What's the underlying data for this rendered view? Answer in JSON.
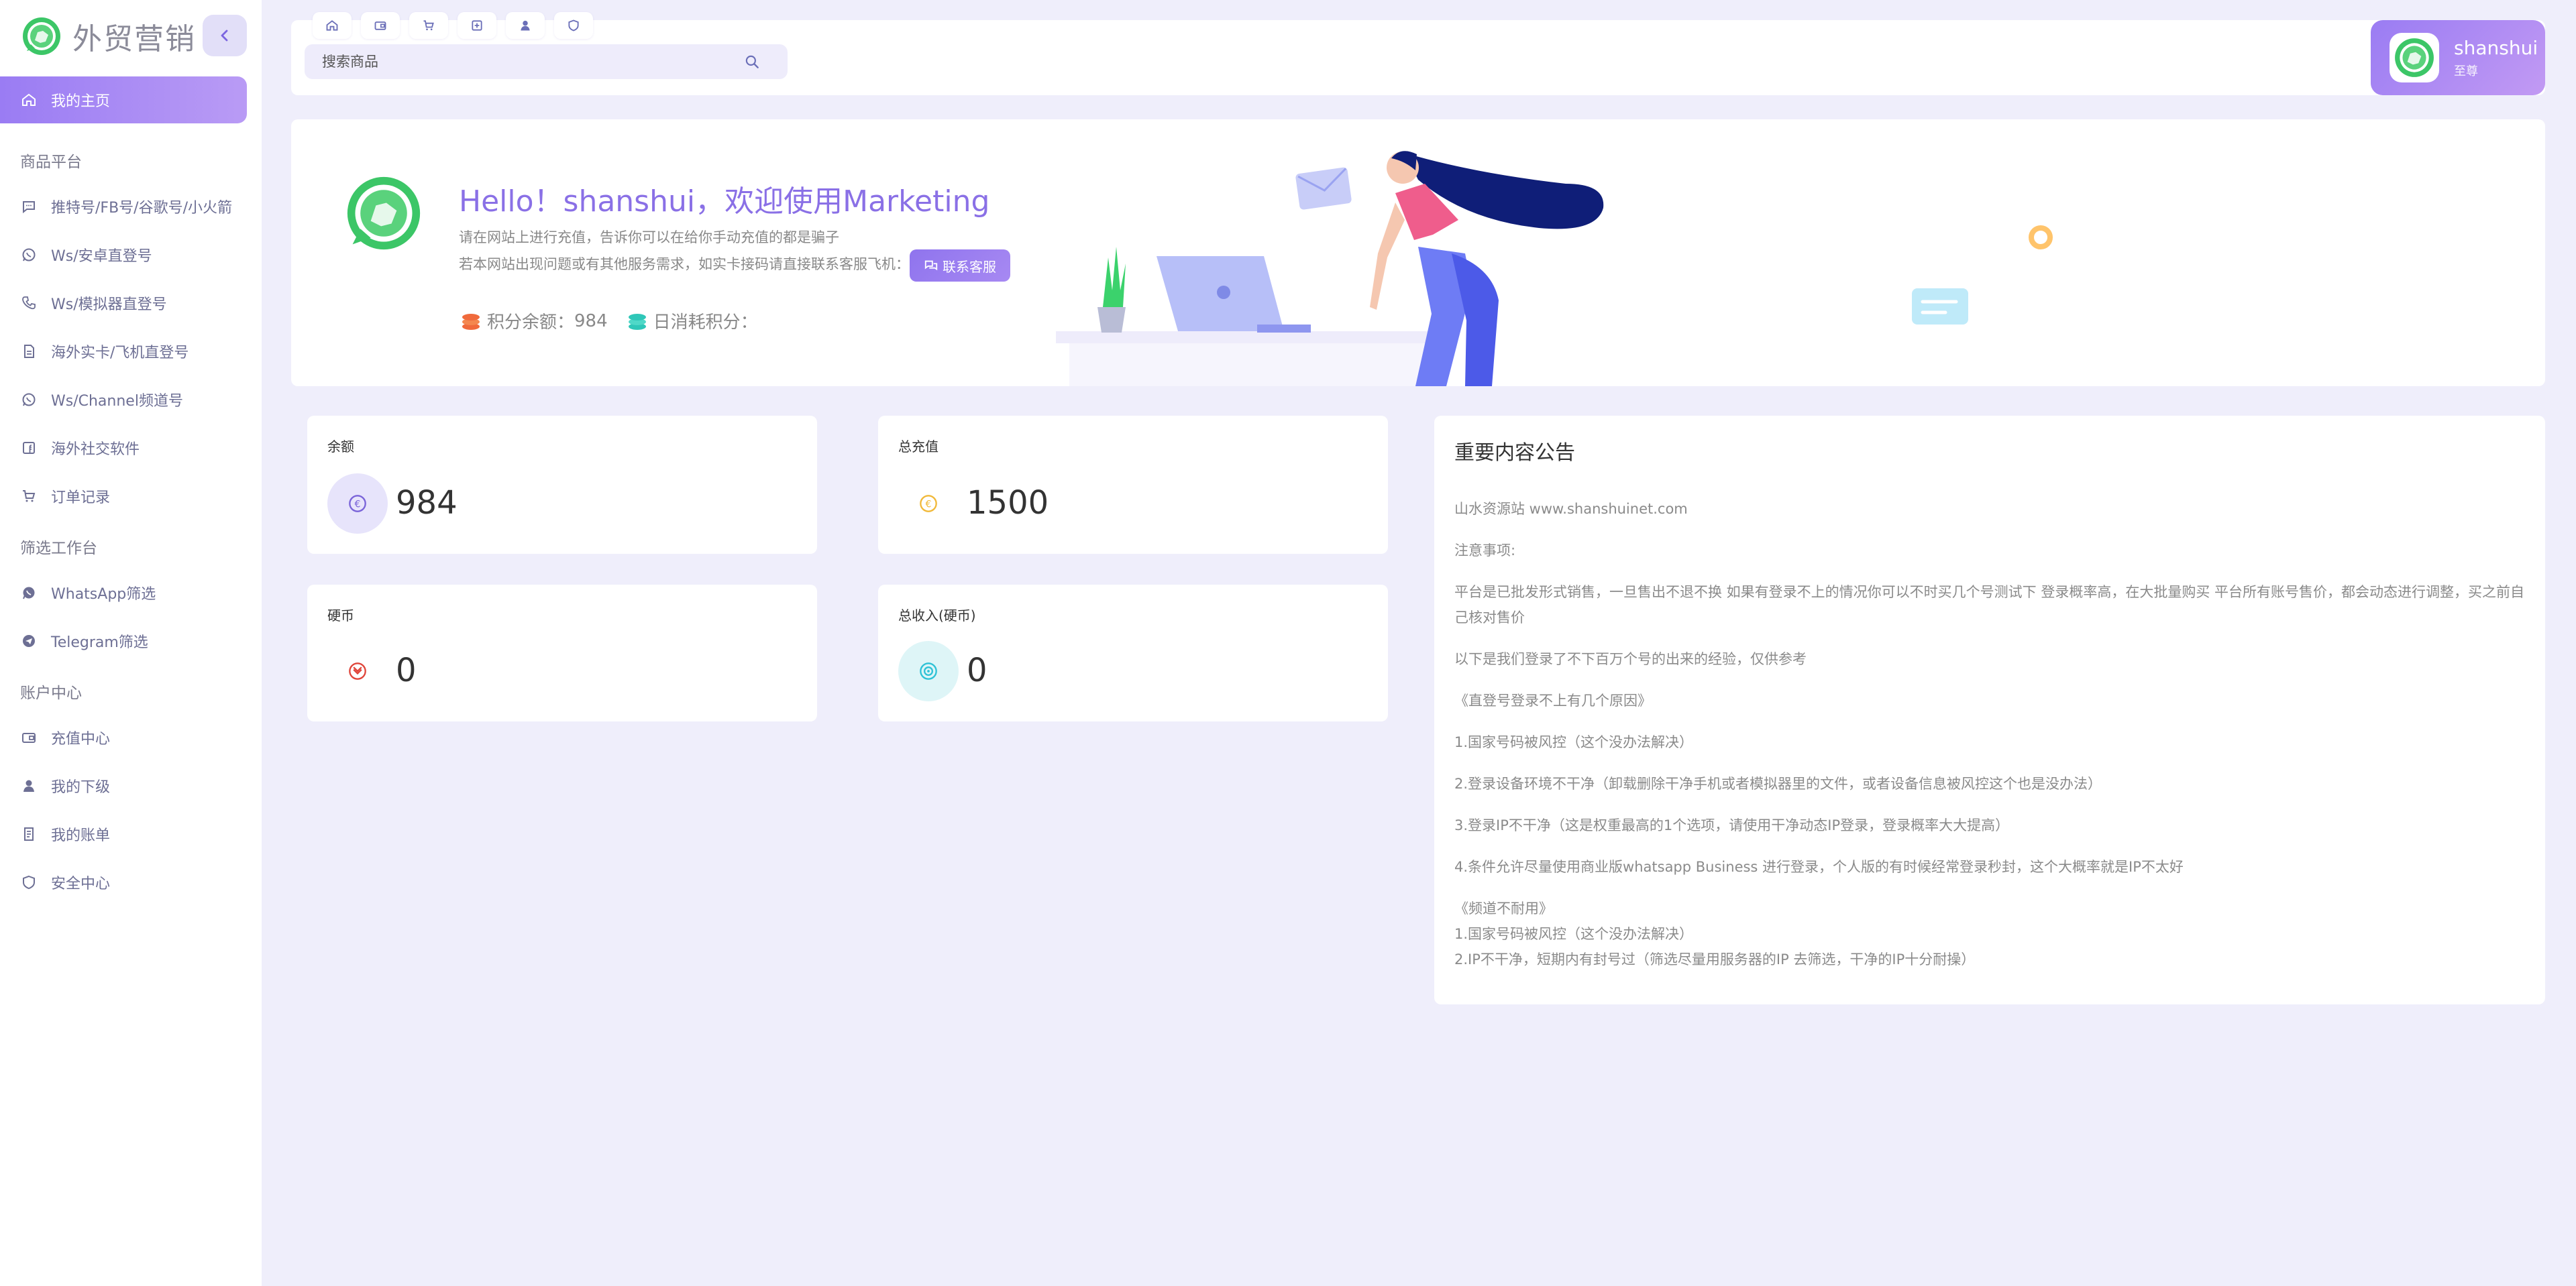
{
  "app": {
    "brand": "外贸营销"
  },
  "sidebar": {
    "home": "我的主页",
    "groups": [
      "商品平台",
      "筛选工作台",
      "账户中心"
    ],
    "items": [
      "推特号/FB号/谷歌号/小火箭",
      "Ws/安卓直登号",
      "Ws/模拟器直登号",
      "海外实卡/飞机直登号",
      "Ws/Channel频道号",
      "海外社交软件",
      "订单记录",
      "WhatsApp筛选",
      "Telegram筛选",
      "充值中心",
      "我的下级",
      "我的账单",
      "安全中心"
    ]
  },
  "header": {
    "search_placeholder": "搜索商品",
    "user": {
      "name": "shanshui",
      "role": "至尊"
    },
    "quick_icons": [
      "home-icon",
      "wallet-icon",
      "cart-icon",
      "plus-box-icon",
      "user-icon",
      "shield-icon"
    ]
  },
  "welcome": {
    "hello": "Hello！shanshui，欢迎使用Marketing",
    "line1": "请在网站上进行充值，告诉你可以在给你手动充值的都是骗子",
    "line2": "若本网站出现问题或有其他服务需求，如实卡接码请直接联系客服飞机：",
    "contact_button": "联系客服",
    "points_label": "积分余额：",
    "points_value": "984",
    "daily_label": "日消耗积分："
  },
  "stats": {
    "balance": {
      "label": "余额",
      "value": "984"
    },
    "total_recharge": {
      "label": "总充值",
      "value": "1500"
    },
    "coins": {
      "label": "硬币",
      "value": "0"
    },
    "total_income": {
      "label": "总收入(硬币)",
      "value": "0"
    }
  },
  "notice": {
    "title": "重要内容公告",
    "lines": [
      "山水资源站 www.shanshuinet.com",
      "注意事项:",
      "平台是已批发形式销售，一旦售出不退不换 如果有登录不上的情况你可以不时买几个号测试下 登录概率高，在大批量购买 平台所有账号售价，都会动态进行调整，买之前自己核对售价",
      "以下是我们登录了不下百万个号的出来的经验，仅供参考",
      "《直登号登录不上有几个原因》",
      "1.国家号码被风控（这个没办法解决）",
      "2.登录设备环境不干净（卸载删除干净手机或者模拟器里的文件，或者设备信息被风控这个也是没办法）",
      "3.登录IP不干净（这是权重最高的1个选项，请使用干净动态IP登录，登录概率大大提高）",
      "4.条件允许尽量使用商业版whatsapp Business 进行登录，个人版的有时候经常登录秒封，这个大概率就是IP不太好",
      "《频道不耐用》",
      "1.国家号码被风控（这个没办法解决）",
      "2.IP不干净，短期内有封号过（筛选尽量用服务器的IP 去筛选，干净的IP十分耐操）"
    ]
  },
  "colors": {
    "accent": "#8f74ee",
    "background": "#efeefb",
    "brand_green": "#3cc667"
  }
}
